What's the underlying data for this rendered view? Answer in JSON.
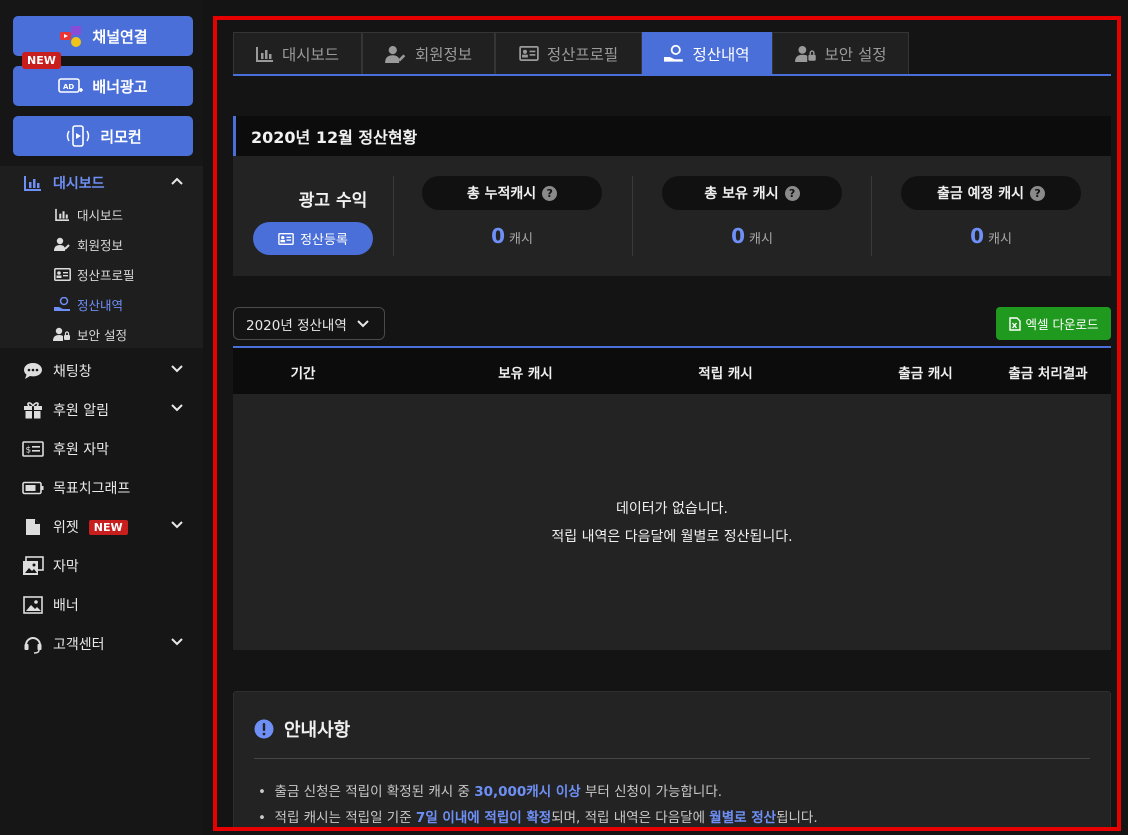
{
  "sidebar": {
    "buttons": [
      {
        "label": "채널연결",
        "icon": "channel-link-icon"
      },
      {
        "label": "배너광고",
        "icon": "ad-banner-icon",
        "tag": "NEW"
      },
      {
        "label": "리모컨",
        "icon": "remote-icon"
      }
    ],
    "nav": [
      {
        "label": "대시보드",
        "icon": "chart-icon",
        "active": true,
        "expanded": true
      },
      {
        "label": "채팅창",
        "icon": "chat-bubble-icon"
      },
      {
        "label": "후원 알림",
        "icon": "gift-icon"
      },
      {
        "label": "후원 자막",
        "icon": "money-bill-icon"
      },
      {
        "label": "목표치그래프",
        "icon": "battery-icon"
      },
      {
        "label": "위젯",
        "icon": "widget-icon",
        "badge": "NEW"
      },
      {
        "label": "자막",
        "icon": "images-icon"
      },
      {
        "label": "배너",
        "icon": "image-icon"
      },
      {
        "label": "고객센터",
        "icon": "headset-icon"
      }
    ],
    "sub_items": [
      {
        "label": "대시보드",
        "icon": "chart-icon"
      },
      {
        "label": "회원정보",
        "icon": "user-edit-icon"
      },
      {
        "label": "정산프로필",
        "icon": "id-card-icon"
      },
      {
        "label": "정산내역",
        "icon": "hand-coin-icon",
        "active": true
      },
      {
        "label": "보안 설정",
        "icon": "user-lock-icon"
      }
    ]
  },
  "tabs": [
    {
      "label": "대시보드",
      "icon": "chart-icon"
    },
    {
      "label": "회원정보",
      "icon": "user-edit-icon"
    },
    {
      "label": "정산프로필",
      "icon": "id-card-icon"
    },
    {
      "label": "정산내역",
      "icon": "hand-coin-icon",
      "active": true
    },
    {
      "label": "보안 설정",
      "icon": "user-lock-icon"
    }
  ],
  "summary": {
    "title": "2020년 12월 정산현황",
    "revenue_label": "광고 수익",
    "register_button": "정산등록",
    "stats": [
      {
        "label": "총 누적캐시",
        "value": "0",
        "unit": "캐시"
      },
      {
        "label": "총 보유 캐시",
        "value": "0",
        "unit": "캐시"
      },
      {
        "label": "출금 예정 캐시",
        "value": "0",
        "unit": "캐시"
      }
    ]
  },
  "history": {
    "year_select": "2020년 정산내역",
    "excel_button": "엑셀 다운로드",
    "columns": [
      "기간",
      "보유 캐시",
      "적립 캐시",
      "출금 캐시",
      "출금 처리결과"
    ],
    "empty_line1": "데이터가 없습니다.",
    "empty_line2": "적립 내역은 다음달에 월별로 정산됩니다."
  },
  "notice": {
    "title": "안내사항",
    "line1_a": "출금 신청은 적립이 확정된 캐시 중 ",
    "line1_hl": "30,000캐시 이상",
    "line1_b": " 부터 신청이 가능합니다.",
    "line2_a": "적립 캐시는 적립일 기준 ",
    "line2_hl1": "7일 이내에 적립이 확정",
    "line2_b": "되며, 적립 내역은 다음달에 ",
    "line2_hl2": "월별로 정산",
    "line2_c": "됩니다."
  },
  "colors": {
    "accent": "#4a6fd8",
    "highlight_frame": "#e60000",
    "excel": "#1f9a1f",
    "new_badge": "#c81e1e"
  }
}
